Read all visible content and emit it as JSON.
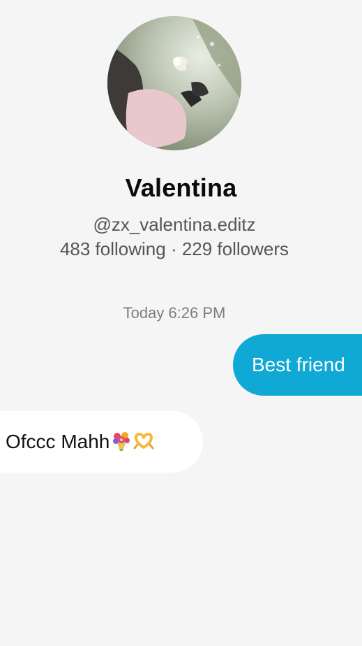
{
  "profile": {
    "display_name": "Valentina",
    "username": "@zx_valentina.editz",
    "stats": "483 following · 229 followers",
    "avatar_icon": "profile-photo"
  },
  "conversation": {
    "timestamp": "Today 6:26 PM",
    "messages": [
      {
        "direction": "outgoing",
        "text": "Best friend"
      },
      {
        "direction": "incoming",
        "text": "Ofccc Mahh",
        "emojis": [
          "bouquet-emoji",
          "heart-hands-emoji"
        ]
      }
    ]
  },
  "colors": {
    "outgoing_bubble": "#10a8d4",
    "incoming_bubble": "#ffffff",
    "background": "#f5f5f5"
  }
}
